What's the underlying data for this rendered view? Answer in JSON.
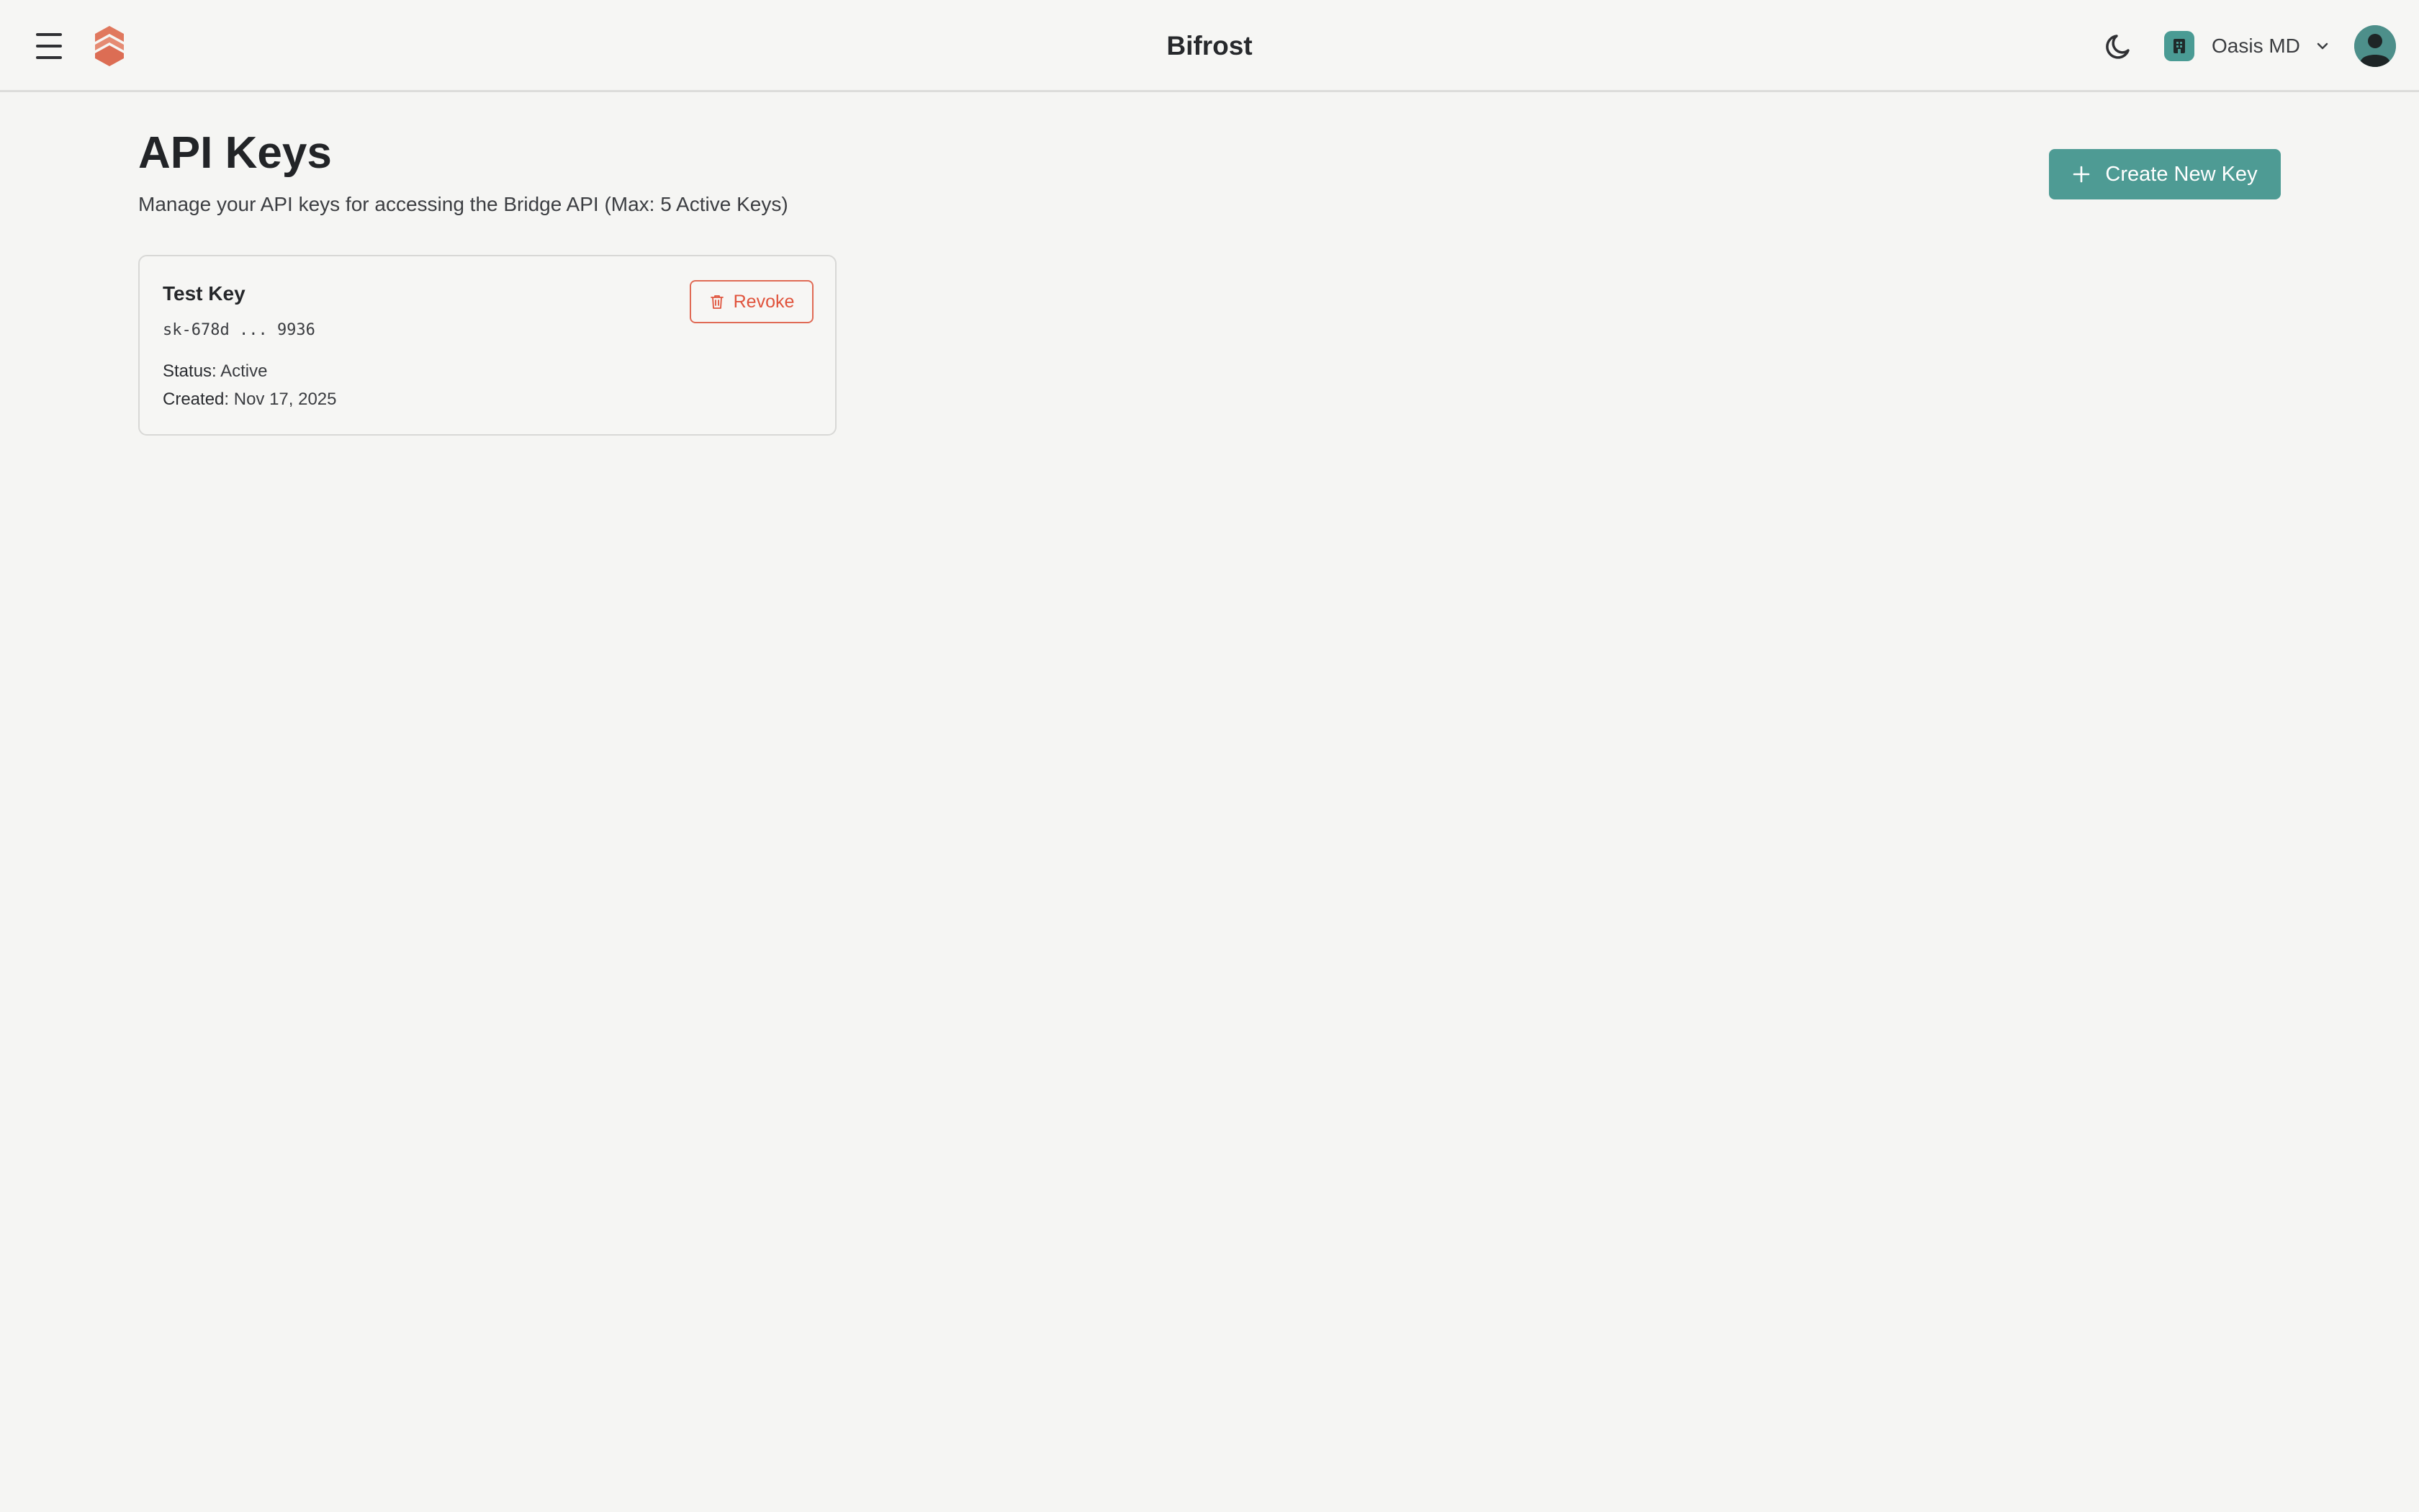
{
  "header": {
    "app_title": "Bifrost",
    "org_name": "Oasis MD",
    "icons": {
      "menu": "hamburger-menu-icon",
      "logo": "hexagon-logo-icon",
      "theme": "moon-icon",
      "org": "building-icon",
      "org_dropdown": "chevron-down-icon",
      "avatar": "user-avatar-icon"
    }
  },
  "page": {
    "title": "API Keys",
    "subtitle": "Manage your API keys for accessing the Bridge API (Max: 5 Active Keys)",
    "create_button_label": "Create New Key"
  },
  "keys": [
    {
      "name": "Test Key",
      "masked_key": "sk-678d ... 9936",
      "status_label": "Status:",
      "status": "Active",
      "created_label": "Created:",
      "created": "Nov 17, 2025",
      "revoke_label": "Revoke"
    }
  ],
  "colors": {
    "accent": "#4e9b94",
    "danger": "#e0533c",
    "logo": "#e0785e",
    "background": "#f5f5f3"
  }
}
